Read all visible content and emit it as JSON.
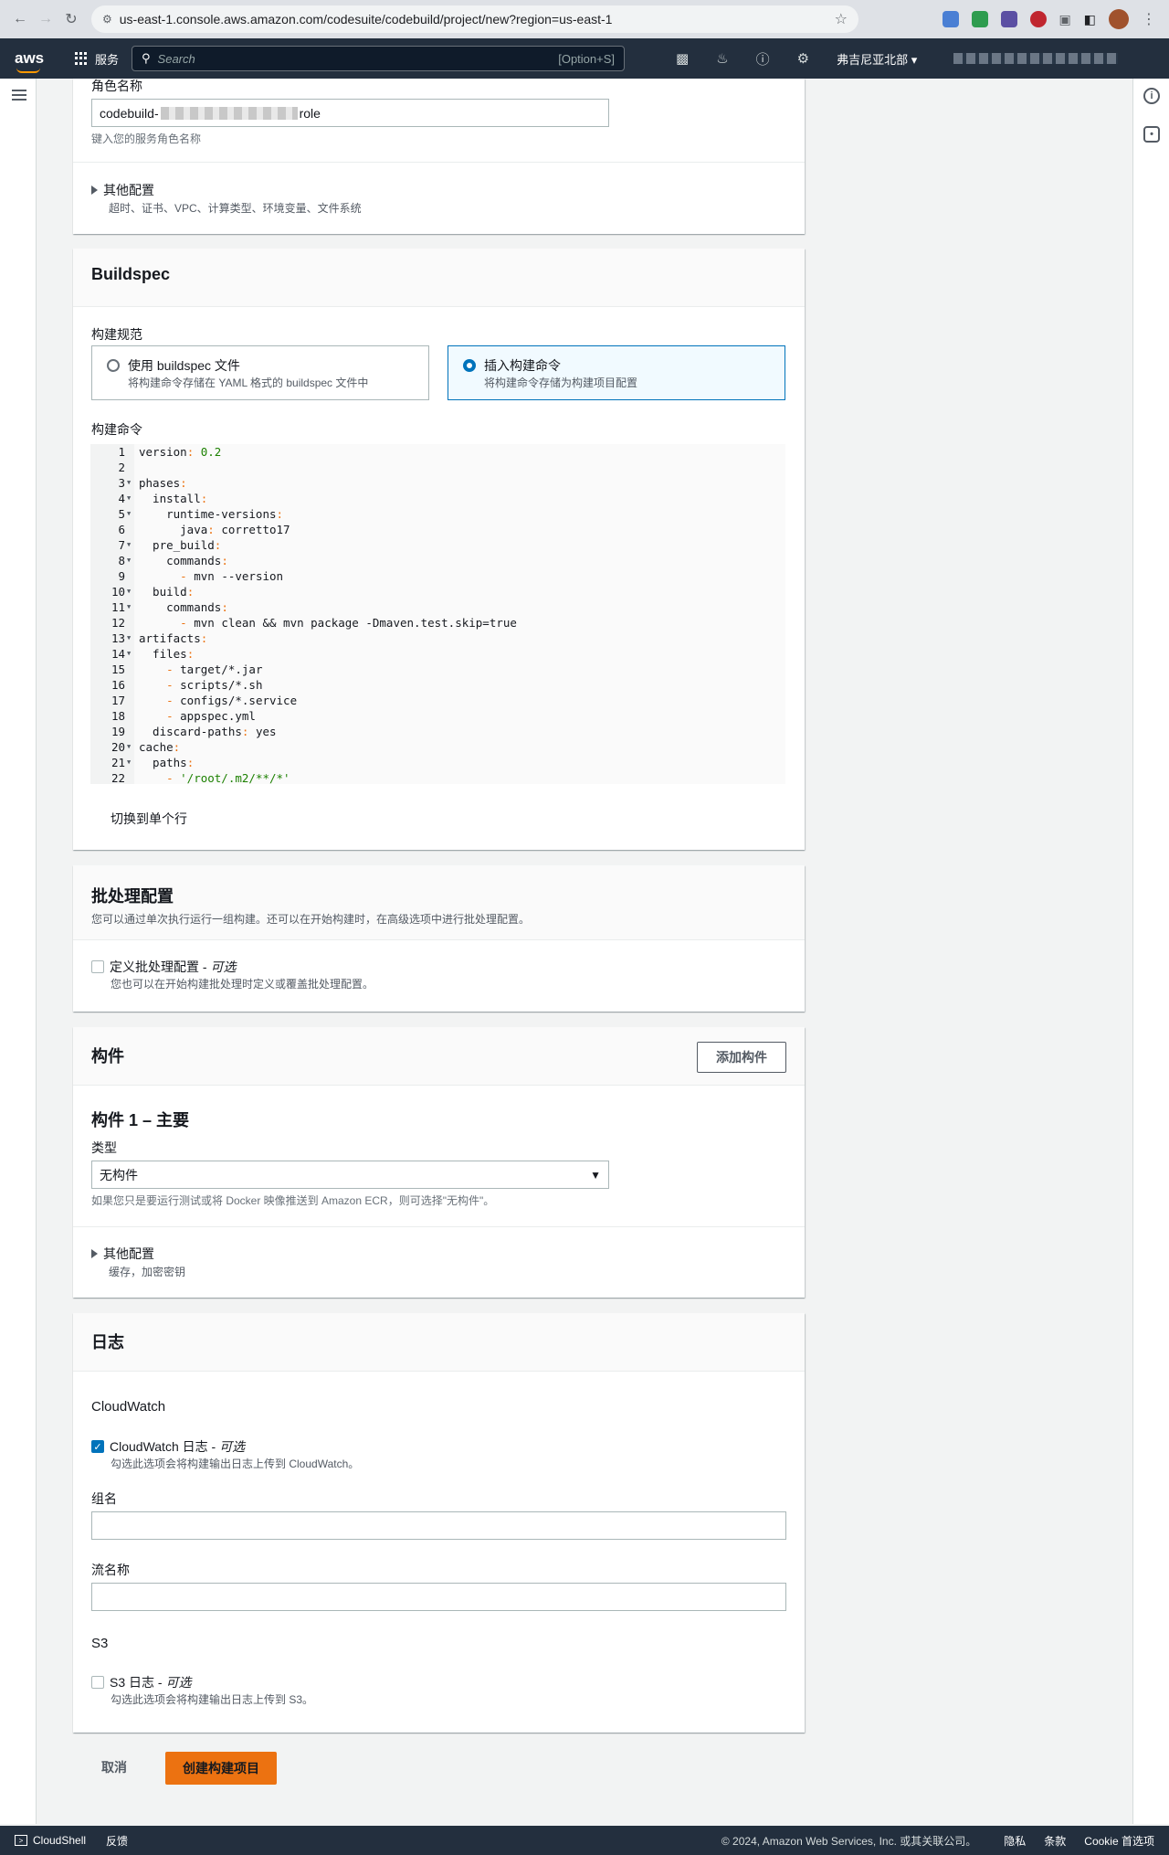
{
  "browser": {
    "url": "us-east-1.console.aws.amazon.com/codesuite/codebuild/project/new?region=us-east-1"
  },
  "aws_nav": {
    "logo": "aws",
    "services": "服务",
    "search_placeholder": "Search",
    "search_shortcut": "[Option+S]",
    "region": "弗吉尼亚北部"
  },
  "service_role": {
    "label": "角色名称",
    "value_prefix": "codebuild-",
    "value_suffix": "role",
    "hint": "键入您的服务角色名称",
    "additional_config": "其他配置",
    "additional_config_desc": "超时、证书、VPC、计算类型、环境变量、文件系统"
  },
  "buildspec": {
    "title": "Buildspec",
    "spec_label": "构建规范",
    "options": [
      {
        "title": "使用 buildspec 文件",
        "desc": "将构建命令存储在 YAML 格式的 buildspec 文件中",
        "selected": false
      },
      {
        "title": "插入构建命令",
        "desc": "将构建命令存储为构建项目配置",
        "selected": true
      }
    ],
    "commands_label": "构建命令",
    "switch_single_line": "切换到单个行"
  },
  "code_lines": [
    {
      "n": "1",
      "fold": false,
      "parts": [
        [
          "k",
          "version"
        ],
        [
          "p",
          ": "
        ],
        [
          "s",
          "0.2"
        ]
      ]
    },
    {
      "n": "2",
      "fold": false,
      "parts": []
    },
    {
      "n": "3",
      "fold": true,
      "parts": [
        [
          "k",
          "phases"
        ],
        [
          "p",
          ":"
        ]
      ]
    },
    {
      "n": "4",
      "fold": true,
      "parts": [
        [
          "k",
          "  install"
        ],
        [
          "p",
          ":"
        ]
      ]
    },
    {
      "n": "5",
      "fold": true,
      "parts": [
        [
          "k",
          "    runtime-versions"
        ],
        [
          "p",
          ":"
        ]
      ]
    },
    {
      "n": "6",
      "fold": false,
      "parts": [
        [
          "k",
          "      java"
        ],
        [
          "p",
          ": "
        ],
        [
          "k",
          "corretto17"
        ]
      ]
    },
    {
      "n": "7",
      "fold": true,
      "parts": [
        [
          "k",
          "  pre_build"
        ],
        [
          "p",
          ":"
        ]
      ]
    },
    {
      "n": "8",
      "fold": true,
      "parts": [
        [
          "k",
          "    commands"
        ],
        [
          "p",
          ":"
        ]
      ]
    },
    {
      "n": "9",
      "fold": false,
      "parts": [
        [
          "p",
          "      - "
        ],
        [
          "k",
          "mvn --version"
        ]
      ]
    },
    {
      "n": "10",
      "fold": true,
      "parts": [
        [
          "k",
          "  build"
        ],
        [
          "p",
          ":"
        ]
      ]
    },
    {
      "n": "11",
      "fold": true,
      "parts": [
        [
          "k",
          "    commands"
        ],
        [
          "p",
          ":"
        ]
      ]
    },
    {
      "n": "12",
      "fold": false,
      "parts": [
        [
          "p",
          "      - "
        ],
        [
          "k",
          "mvn clean && mvn package -Dmaven.test.skip=true"
        ]
      ]
    },
    {
      "n": "13",
      "fold": true,
      "parts": [
        [
          "k",
          "artifacts"
        ],
        [
          "p",
          ":"
        ]
      ]
    },
    {
      "n": "14",
      "fold": true,
      "parts": [
        [
          "k",
          "  files"
        ],
        [
          "p",
          ":"
        ]
      ]
    },
    {
      "n": "15",
      "fold": false,
      "parts": [
        [
          "p",
          "    - "
        ],
        [
          "k",
          "target/*.jar"
        ]
      ]
    },
    {
      "n": "16",
      "fold": false,
      "parts": [
        [
          "p",
          "    - "
        ],
        [
          "k",
          "scripts/*.sh"
        ]
      ]
    },
    {
      "n": "17",
      "fold": false,
      "parts": [
        [
          "p",
          "    - "
        ],
        [
          "k",
          "configs/*.service"
        ]
      ]
    },
    {
      "n": "18",
      "fold": false,
      "parts": [
        [
          "p",
          "    - "
        ],
        [
          "k",
          "appspec.yml"
        ]
      ]
    },
    {
      "n": "19",
      "fold": false,
      "parts": [
        [
          "k",
          "  discard-paths"
        ],
        [
          "p",
          ": "
        ],
        [
          "k",
          "yes"
        ]
      ]
    },
    {
      "n": "20",
      "fold": true,
      "parts": [
        [
          "k",
          "cache"
        ],
        [
          "p",
          ":"
        ]
      ]
    },
    {
      "n": "21",
      "fold": true,
      "parts": [
        [
          "k",
          "  paths"
        ],
        [
          "p",
          ":"
        ]
      ]
    },
    {
      "n": "22",
      "fold": false,
      "parts": [
        [
          "p",
          "    - "
        ],
        [
          "s",
          "'/root/.m2/**/*'"
        ]
      ]
    }
  ],
  "batch": {
    "title": "批处理配置",
    "desc": "您可以通过单次执行运行一组构建。还可以在开始构建时，在高级选项中进行批处理配置。",
    "checkbox_label": "定义批处理配置 - ",
    "optional": "可选",
    "checkbox_hint": "您也可以在开始构建批处理时定义或覆盖批处理配置。"
  },
  "artifacts": {
    "title": "构件",
    "add_button": "添加构件",
    "primary_title": "构件 1 – 主要",
    "type_label": "类型",
    "type_value": "无构件",
    "type_hint": "如果您只是要运行测试或将 Docker 映像推送到 Amazon ECR，则可选择\"无构件\"。",
    "additional_config": "其他配置",
    "additional_config_desc": "缓存，加密密钥"
  },
  "logs": {
    "title": "日志",
    "cloudwatch_heading": "CloudWatch",
    "cloudwatch_label": "CloudWatch 日志 - ",
    "optional": "可选",
    "cloudwatch_hint": "勾选此选项会将构建输出日志上传到 CloudWatch。",
    "group_label": "组名",
    "group_value": "",
    "stream_label": "流名称",
    "stream_value": "",
    "s3_heading": "S3",
    "s3_label": "S3 日志 - ",
    "s3_hint": "勾选此选项会将构建输出日志上传到 S3。"
  },
  "footer_actions": {
    "cancel": "取消",
    "create": "创建构建项目"
  },
  "bottom_bar": {
    "cloudshell": "CloudShell",
    "feedback": "反馈",
    "copyright": "© 2024, Amazon Web Services, Inc. 或其关联公司。",
    "privacy": "隐私",
    "terms": "条款",
    "cookie": "Cookie 首选项"
  }
}
